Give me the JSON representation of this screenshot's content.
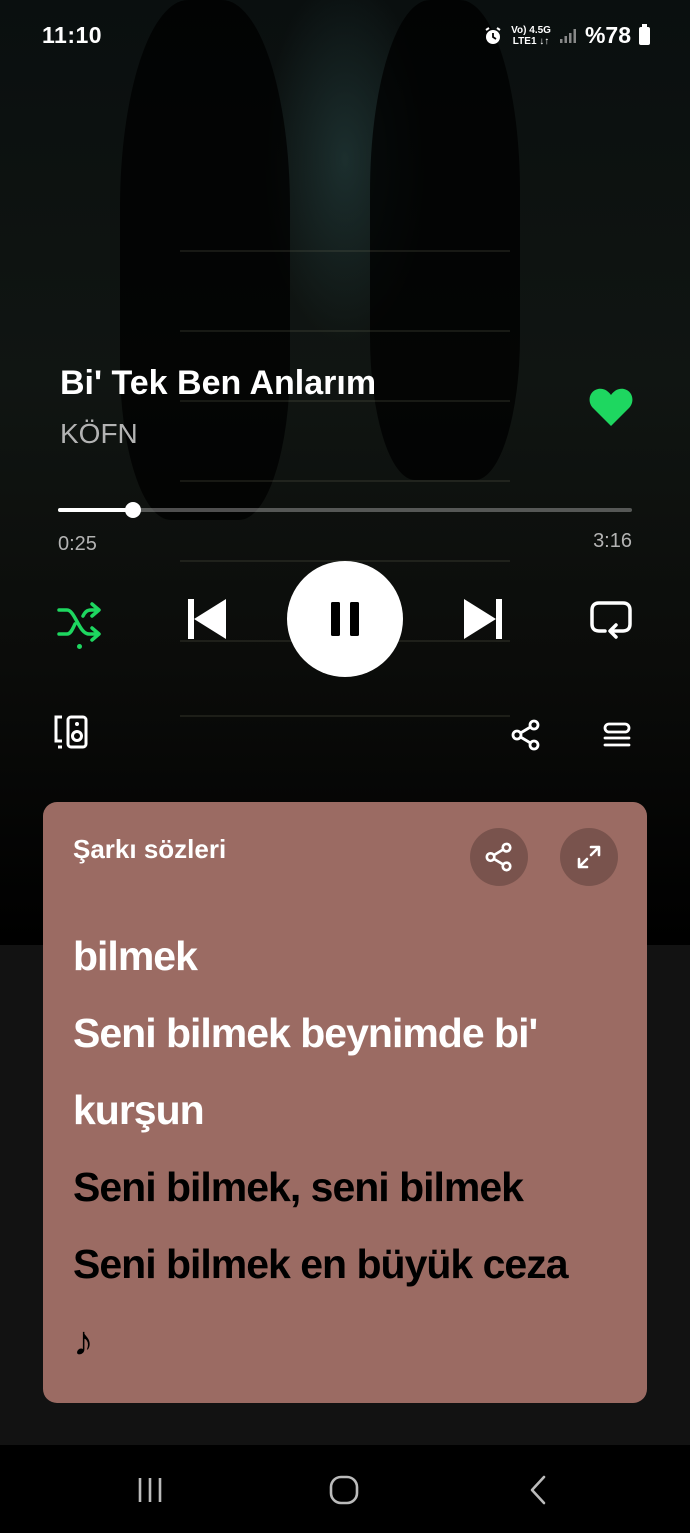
{
  "status_bar": {
    "time": "11:10",
    "network_top": "Vo) 4.5G",
    "network_bottom": "LTE1 ↓↑",
    "battery": "%78",
    "icons": [
      "alarm-icon",
      "signal-icon",
      "battery-icon"
    ]
  },
  "track": {
    "title": "Bi' Tek Ben Anlarım",
    "artist": "KÖFN",
    "liked": true
  },
  "playback": {
    "current_time": "0:25",
    "duration": "3:16",
    "progress_fraction": 0.13,
    "state": "playing",
    "shuffle": true
  },
  "lyrics": {
    "header": "Şarkı sözleri",
    "lines": [
      {
        "text": "bilmek",
        "state": "past"
      },
      {
        "text": "Seni bilmek beynimde bi'",
        "state": "past"
      },
      {
        "text": "kurşun",
        "state": "past"
      },
      {
        "text": "Seni bilmek, seni bilmek",
        "state": "future"
      },
      {
        "text": "Seni bilmek en büyük ceza",
        "state": "future"
      },
      {
        "text": "♪",
        "state": "future"
      }
    ]
  },
  "colors": {
    "accent": "#1ed760",
    "lyrics_card": "#9b6b63",
    "muted_text": "#b3b3b3"
  }
}
